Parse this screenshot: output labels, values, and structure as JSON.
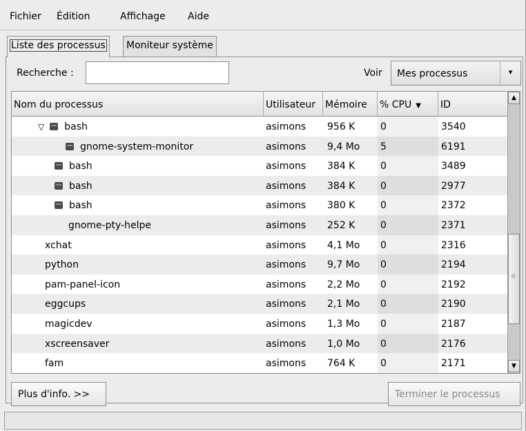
{
  "menu": {
    "items": [
      {
        "label": "Fichier"
      },
      {
        "label": "Édition"
      },
      {
        "label": "Affichage"
      },
      {
        "label": "Aide"
      }
    ]
  },
  "tabs": [
    {
      "label": "Liste des processus",
      "active": true
    },
    {
      "label": "Moniteur système",
      "active": false
    }
  ],
  "search": {
    "label": "Recherche :",
    "value": ""
  },
  "view": {
    "label": "Voir",
    "selected": "Mes processus"
  },
  "table": {
    "columns": [
      "Nom du processus",
      "Utilisateur",
      "Mémoire",
      "% CPU",
      "ID"
    ],
    "sorted_column": "% CPU",
    "rows": [
      {
        "name": "bash",
        "user": "asimons",
        "memory": "956 K",
        "cpu": "0",
        "id": "3540",
        "level": 1,
        "expanded": true,
        "icon": "terminal-icon"
      },
      {
        "name": "gnome-system-monitor",
        "user": "asimons",
        "memory": "9,4 Mo",
        "cpu": "5",
        "id": "6191",
        "level": 2,
        "icon": "terminal-icon"
      },
      {
        "name": "bash",
        "user": "asimons",
        "memory": "384 K",
        "cpu": "0",
        "id": "3489",
        "level": 1,
        "icon": "terminal-icon"
      },
      {
        "name": "bash",
        "user": "asimons",
        "memory": "384 K",
        "cpu": "0",
        "id": "2977",
        "level": 1,
        "icon": "terminal-icon"
      },
      {
        "name": "bash",
        "user": "asimons",
        "memory": "380 K",
        "cpu": "0",
        "id": "2372",
        "level": 1,
        "icon": "terminal-icon"
      },
      {
        "name": "gnome-pty-helpe",
        "user": "asimons",
        "memory": "252 K",
        "cpu": "0",
        "id": "2371",
        "level": 1
      },
      {
        "name": "xchat",
        "user": "asimons",
        "memory": "4,1 Mo",
        "cpu": "0",
        "id": "2316",
        "level": 0
      },
      {
        "name": "python",
        "user": "asimons",
        "memory": "9,7 Mo",
        "cpu": "0",
        "id": "2194",
        "level": 0
      },
      {
        "name": "pam-panel-icon",
        "user": "asimons",
        "memory": "2,2 Mo",
        "cpu": "0",
        "id": "2192",
        "level": 0
      },
      {
        "name": "eggcups",
        "user": "asimons",
        "memory": "2,1 Mo",
        "cpu": "0",
        "id": "2190",
        "level": 0
      },
      {
        "name": "magicdev",
        "user": "asimons",
        "memory": "1,3 Mo",
        "cpu": "0",
        "id": "2187",
        "level": 0
      },
      {
        "name": "xscreensaver",
        "user": "asimons",
        "memory": "1,0 Mo",
        "cpu": "0",
        "id": "2176",
        "level": 0
      },
      {
        "name": "fam",
        "user": "asimons",
        "memory": "764 K",
        "cpu": "0",
        "id": "2171",
        "level": 0
      }
    ]
  },
  "buttons": {
    "more_info": "Plus d'info. >>",
    "end_process": "Terminer le processus"
  },
  "status": ""
}
